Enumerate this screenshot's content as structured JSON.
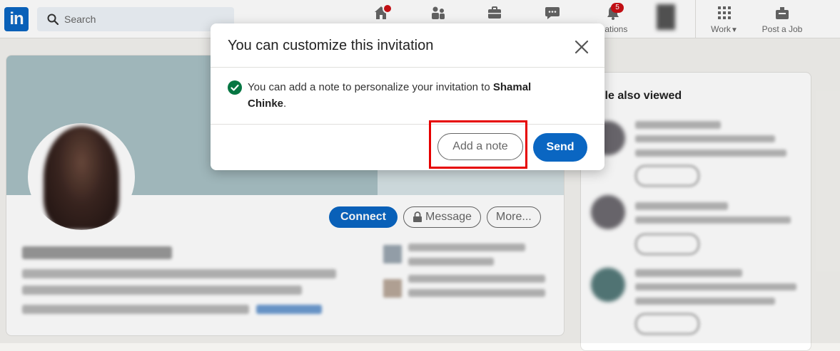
{
  "header": {
    "logo_text": "in",
    "search_placeholder": "Search",
    "nav": {
      "home_badge": "",
      "notifications_badge": "5",
      "notifications_label": "ications",
      "work_label": "Work",
      "post_job_label": "Post a Job"
    }
  },
  "profile": {
    "connect_label": "Connect",
    "message_label": "Message",
    "more_label": "More..."
  },
  "sidebar": {
    "title": "ople also viewed"
  },
  "modal": {
    "title": "You can customize this invitation",
    "message_prefix": "You can add a note to personalize your invitation to ",
    "name": "Shamal Chinke",
    "message_suffix": ".",
    "add_note_label": "Add a note",
    "send_label": "Send"
  },
  "colors": {
    "accent": "#0a66c2",
    "highlight": "#e60000",
    "success": "#057642",
    "badge": "#cc1016"
  }
}
